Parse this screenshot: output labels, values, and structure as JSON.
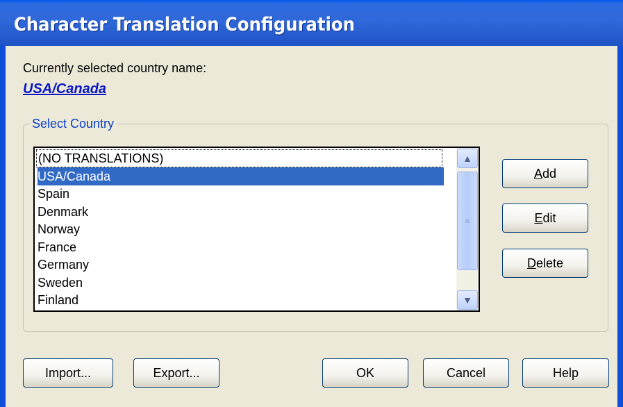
{
  "window": {
    "title": "Character Translation Configuration"
  },
  "current": {
    "label": "Currently selected country name:",
    "value": "USA/Canada"
  },
  "group": {
    "legend": "Select Country"
  },
  "countries": [
    "(NO TRANSLATIONS)",
    "USA/Canada",
    "Spain",
    "Denmark",
    "Norway",
    "France",
    "Germany",
    "Sweden",
    "Finland"
  ],
  "selected_index": 1,
  "side_buttons": {
    "add": {
      "mnemonic": "A",
      "rest": "dd"
    },
    "edit": {
      "mnemonic": "E",
      "rest": "dit"
    },
    "delete": {
      "mnemonic": "D",
      "rest": "elete"
    }
  },
  "bottom_buttons": {
    "import": "Import...",
    "export": "Export...",
    "ok": "OK",
    "cancel": "Cancel",
    "help": "Help"
  },
  "icons": {
    "scroll_up": "chevron-up-icon",
    "scroll_down": "chevron-down-icon"
  },
  "colors": {
    "titlebar": "#2e67d8",
    "selection": "#316ac5",
    "link": "#0a18c4"
  }
}
